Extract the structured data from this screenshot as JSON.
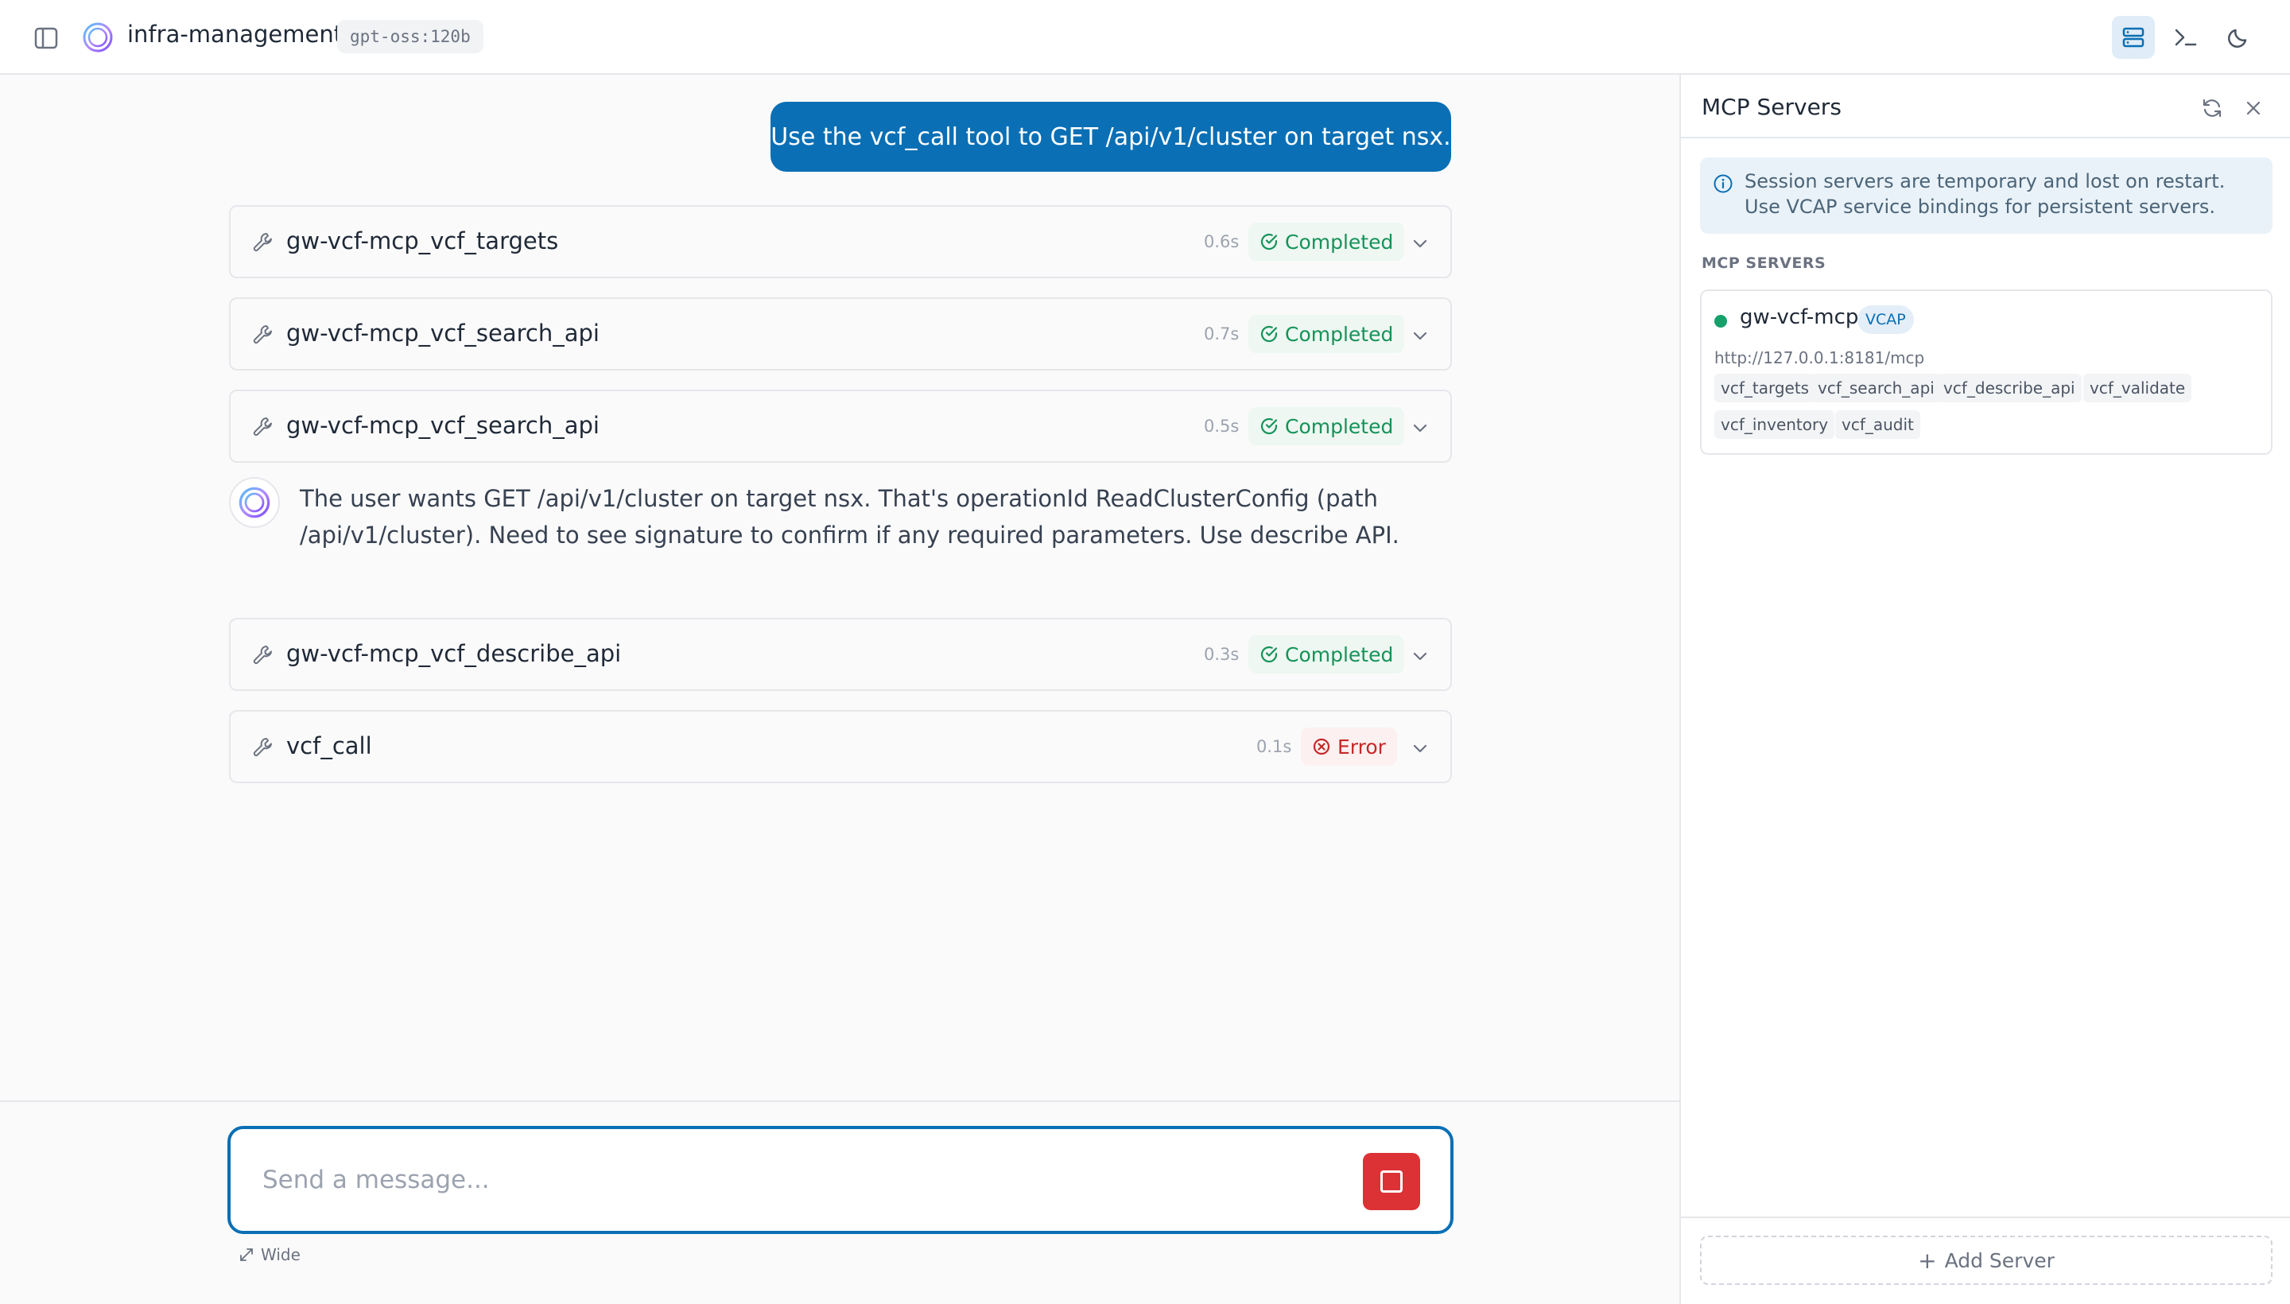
{
  "header": {
    "app_title": "infra-management",
    "model": "gpt-oss:120b"
  },
  "chat": {
    "user_message": "Use the vcf_call tool to GET /api/v1/cluster on target nsx.",
    "tool_calls": [
      {
        "name": "gw-vcf-mcp_vcf_targets",
        "duration": "0.6s",
        "status": "Completed"
      },
      {
        "name": "gw-vcf-mcp_vcf_search_api",
        "duration": "0.7s",
        "status": "Completed"
      },
      {
        "name": "gw-vcf-mcp_vcf_search_api",
        "duration": "0.5s",
        "status": "Completed"
      },
      {
        "name": "gw-vcf-mcp_vcf_describe_api",
        "duration": "0.3s",
        "status": "Completed"
      },
      {
        "name": "vcf_call",
        "duration": "0.1s",
        "status": "Error"
      }
    ],
    "assistant_text": "The user wants GET /api/v1/cluster on target nsx. That's operationId ReadClusterConfig (path /api/v1/cluster). Need to see signature to confirm if any required parameters. Use describe API."
  },
  "composer": {
    "placeholder": "Send a message...",
    "wide_label": "Wide"
  },
  "panel": {
    "title": "MCP Servers",
    "info": "Session servers are temporary and lost on restart. Use VCAP service bindings for persistent servers.",
    "section_label": "MCP SERVERS",
    "server": {
      "name": "gw-vcf-mcp",
      "badge": "VCAP",
      "url": "http://127.0.0.1:8181/mcp",
      "status": "connected",
      "tools": [
        "vcf_targets",
        "vcf_search_api",
        "vcf_describe_api",
        "vcf_validate",
        "vcf_inventory",
        "vcf_audit"
      ]
    },
    "add_server_label": "Add Server"
  },
  "colors": {
    "accent": "#0a6fb5",
    "success": "#15935a",
    "error": "#c62828",
    "stop": "#dc3236"
  }
}
